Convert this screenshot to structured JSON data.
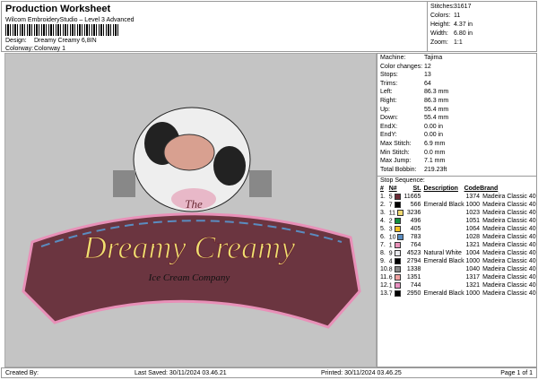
{
  "header": {
    "title": "Production Worksheet",
    "subtitle": "Wilcom EmbroideryStudio – Level 3 Advanced",
    "design_label": "Design:",
    "design_value": "Dreamy Creamy 6,8IN",
    "colorway_label": "Colorway:",
    "colorway_value": "Colorway 1"
  },
  "stats": [
    {
      "label": "Stitches:",
      "value": "31617"
    },
    {
      "label": "Colors:",
      "value": "11"
    },
    {
      "label": "Height:",
      "value": "4.37 in"
    },
    {
      "label": "Width:",
      "value": "6.80 in"
    },
    {
      "label": "Zoom:",
      "value": "1:1"
    }
  ],
  "info": [
    {
      "label": "Machine:",
      "value": "Tajima"
    },
    {
      "label": "Color changes:",
      "value": "12"
    },
    {
      "label": "Stops:",
      "value": "13"
    },
    {
      "label": "Trims:",
      "value": "64"
    },
    {
      "label": "Left:",
      "value": "86.3 mm"
    },
    {
      "label": "Right:",
      "value": "86.3 mm"
    },
    {
      "label": "Up:",
      "value": "55.4 mm"
    },
    {
      "label": "Down:",
      "value": "55.4 mm"
    },
    {
      "label": "EndX:",
      "value": "0.00 in"
    },
    {
      "label": "EndY:",
      "value": "0.00 in"
    },
    {
      "label": "Max Stitch:",
      "value": "6.9 mm"
    },
    {
      "label": "Min Stitch:",
      "value": "0.0 mm"
    },
    {
      "label": "Max Jump:",
      "value": "7.1 mm"
    },
    {
      "label": "Total Bobbin:",
      "value": "219.23ft"
    }
  ],
  "stop_sequence": {
    "title": "Stop Sequence:",
    "headers": [
      "#",
      "N#",
      "St.",
      "Description",
      "Code",
      "Brand"
    ],
    "rows": [
      {
        "n": "1.",
        "nn": "5",
        "color": "#6b2a35",
        "st": "11665",
        "desc": "",
        "code": "1374",
        "brand": "Madeira Classic 40"
      },
      {
        "n": "2.",
        "nn": "7",
        "color": "#000000",
        "st": "566",
        "desc": "Emerald Black",
        "code": "1000",
        "brand": "Madeira Classic 40"
      },
      {
        "n": "3.",
        "nn": "11",
        "color": "#f0d870",
        "st": "3236",
        "desc": "",
        "code": "1023",
        "brand": "Madeira Classic 40"
      },
      {
        "n": "4.",
        "nn": "2",
        "color": "#129040",
        "st": "496",
        "desc": "",
        "code": "1051",
        "brand": "Madeira Classic 40"
      },
      {
        "n": "5.",
        "nn": "3",
        "color": "#f5c020",
        "st": "405",
        "desc": "",
        "code": "1064",
        "brand": "Madeira Classic 40"
      },
      {
        "n": "6.",
        "nn": "10",
        "color": "#5a8cc0",
        "st": "783",
        "desc": "",
        "code": "1028",
        "brand": "Madeira Classic 40"
      },
      {
        "n": "7.",
        "nn": "1",
        "color": "#e890b8",
        "st": "764",
        "desc": "",
        "code": "1321",
        "brand": "Madeira Classic 40"
      },
      {
        "n": "8.",
        "nn": "9",
        "color": "#e8e8ec",
        "st": "4523",
        "desc": "Natural White",
        "code": "1004",
        "brand": "Madeira Classic 40"
      },
      {
        "n": "9.",
        "nn": "4",
        "color": "#000000",
        "st": "2794",
        "desc": "Emerald Black",
        "code": "1000",
        "brand": "Madeira Classic 40"
      },
      {
        "n": "10.",
        "nn": "8",
        "color": "#888888",
        "st": "1338",
        "desc": "",
        "code": "1040",
        "brand": "Madeira Classic 40"
      },
      {
        "n": "11.",
        "nn": "6",
        "color": "#f0a0a0",
        "st": "1351",
        "desc": "",
        "code": "1317",
        "brand": "Madeira Classic 40"
      },
      {
        "n": "12.",
        "nn": "1",
        "color": "#e890c0",
        "st": "744",
        "desc": "",
        "code": "1321",
        "brand": "Madeira Classic 40"
      },
      {
        "n": "13.",
        "nn": "7",
        "color": "#000000",
        "st": "2950",
        "desc": "Emerald Black",
        "code": "1000",
        "brand": "Madeira Classic 40"
      }
    ]
  },
  "design_text": {
    "the": "The",
    "main": "Dreamy Creamy",
    "sub": "Ice Cream Company"
  },
  "footer": {
    "created": "Created By:",
    "saved": "Last Saved: 30/11/2024 03.46.21",
    "printed": "Printed: 30/11/2024 03.46.25",
    "page": "Page 1 of 1"
  }
}
